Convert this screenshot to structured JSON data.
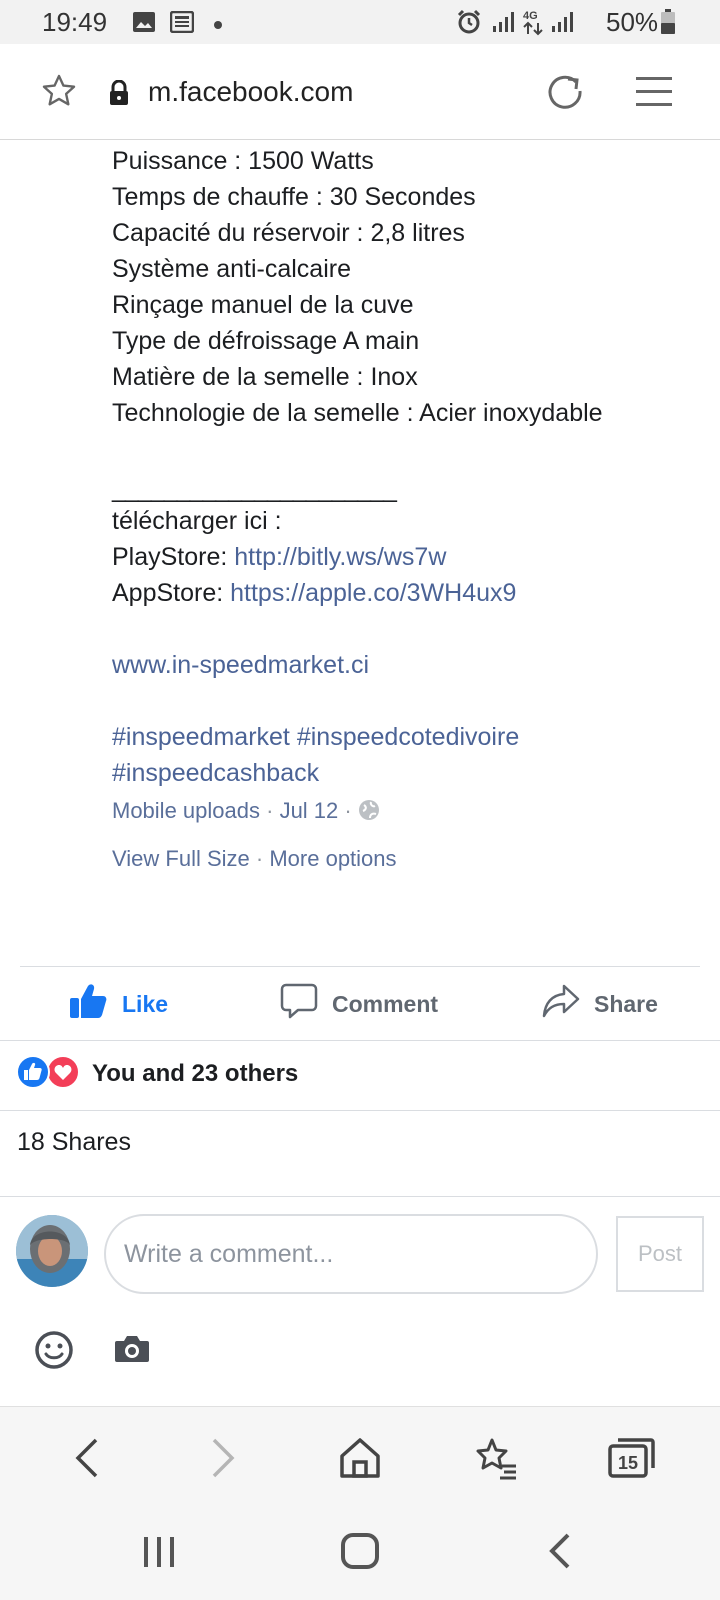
{
  "status_bar": {
    "time": "19:49",
    "battery": "50%",
    "icons": [
      "image-icon",
      "news-icon",
      "dot-icon",
      "alarm-icon",
      "signal-icon",
      "4g-icon",
      "signal-icon",
      "battery-icon"
    ]
  },
  "browser": {
    "url": "m.facebook.com",
    "icons": [
      "star-icon",
      "lock-icon",
      "reload-icon",
      "menu-icon"
    ]
  },
  "post": {
    "spec_lines": [
      "Puissance : 1500 Watts",
      "Temps de chauffe : 30 Secondes",
      "Capacité du réservoir : 2,8 litres",
      "Système anti-calcaire",
      "Rinçage manuel de la cuve",
      "Type de défroissage A main",
      "Matière de la semelle : Inox",
      "Technologie de la semelle : Acier inoxydable"
    ],
    "separator": "______________________",
    "download_label": "télécharger ici :",
    "playstore_label": "PlayStore: ",
    "playstore_link": "http://bitly.ws/ws7w",
    "appstore_label": "AppStore: ",
    "appstore_link": "https://apple.co/3WH4ux9",
    "website": "www.in-speedmarket.ci",
    "hashtag_1": "#inspeedmarket",
    "hashtag_2": "#inspeedcotedivoire",
    "hashtag_3": "#inspeedcashback",
    "album": "Mobile uploads",
    "date": "Jul 12",
    "view_full_size": "View Full Size",
    "more_options": "More options",
    "meta_separator": "·"
  },
  "actions": {
    "like": "Like",
    "comment": "Comment",
    "share": "Share"
  },
  "reactions": {
    "summary": "You and 23 others"
  },
  "shares_text": "18 Shares",
  "composer": {
    "placeholder": "Write a comment...",
    "post_label": "Post"
  },
  "bottom_bar": {
    "tabs_count": "15"
  },
  "colors": {
    "link": "#4b6396",
    "like_blue": "#1877f2",
    "love_red": "#f33e58"
  }
}
